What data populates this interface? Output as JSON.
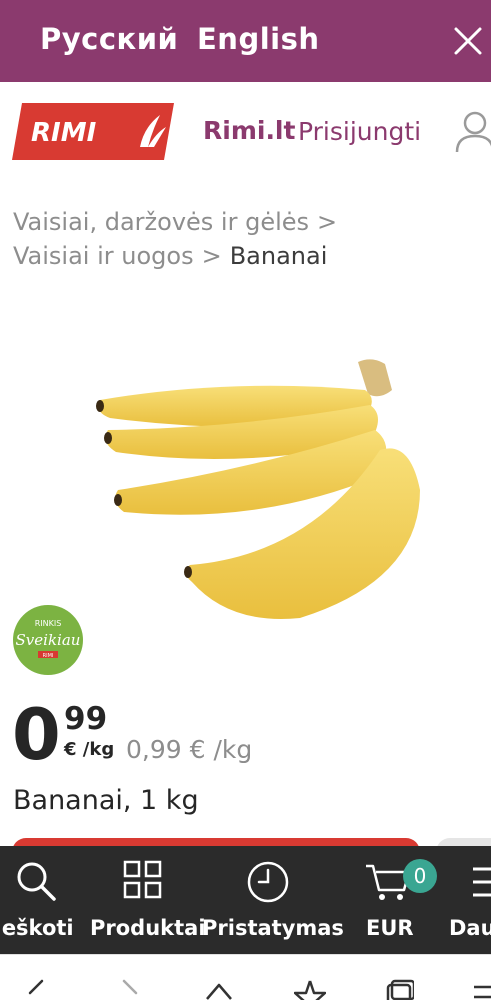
{
  "language_bar": {
    "russian": "Русский",
    "english": "English",
    "background": "#8b3a6e"
  },
  "header": {
    "logo_text": "RIMI",
    "site_link": "Rimi.lt",
    "login_link": "Prisijungti"
  },
  "breadcrumbs": {
    "level1": "Vaisiai, daržovės ir gėlės",
    "level2": "Vaisiai ir uogos",
    "current": "Bananai",
    "separator": ">"
  },
  "product": {
    "badge": {
      "top": "RINKIS",
      "script": "Sveikiau",
      "brand": "RIMI"
    },
    "price_integer": "0",
    "price_decimal": "99",
    "price_unit": "€ /kg",
    "price_compare": "0,99 € /kg",
    "name": "Bananai, 1 kg"
  },
  "bottom_nav": {
    "search": "Ieškoti",
    "products": "Produktai",
    "delivery": "Pristatymas",
    "cart": "EUR",
    "cart_count": "0",
    "more": "Dau"
  },
  "colors": {
    "brand_purple": "#8b3a6e",
    "brand_red": "#d83a32",
    "nav_bg": "#2b2b2b",
    "badge_green": "#3aa692"
  }
}
